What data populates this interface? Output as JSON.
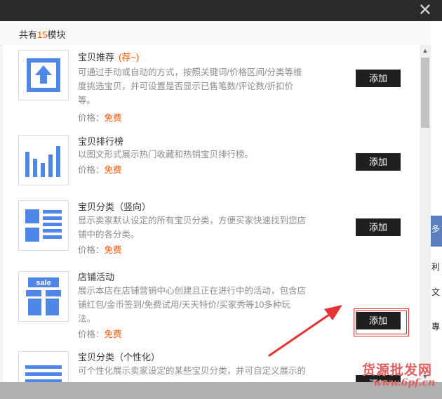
{
  "header": {
    "prefix": "共有",
    "count": "15",
    "suffix": "模块"
  },
  "icons": {
    "close": "close-icon",
    "arrow": "annotation-arrow"
  },
  "colors": {
    "accent": "#ff5500",
    "thumb_blue": "#4f87e8",
    "button": "#1f1f1f",
    "annotation": "#e33333"
  },
  "modules": [
    {
      "title": "宝贝推荐",
      "tag": "(荐~)",
      "desc": [
        "可通过手动或自动的方式，按照关键词/价格区间/分类等维",
        "度挑选宝贝，并可设置是否显示已售笔数/评论数/折扣价",
        "等。"
      ],
      "price_label": "价格：",
      "price": "免费",
      "button": "添加",
      "icon": "upload-arrow-icon"
    },
    {
      "title": "宝贝排行榜",
      "tag": "",
      "desc": [
        "以图文形式展示热门收藏和热销宝贝排行榜。"
      ],
      "price_label": "价格：",
      "price": "免费",
      "button": "添加",
      "icon": "bar-chart-icon"
    },
    {
      "title": "宝贝分类（竖向）",
      "tag": "",
      "desc": [
        "显示卖家默认设定的所有宝贝分类，方便买家快速找到您店",
        "铺中的各分类。"
      ],
      "price_label": "价格：",
      "price": "免费",
      "button": "添加",
      "icon": "category-list-icon"
    },
    {
      "title": "店铺活动",
      "tag": "",
      "desc": [
        "展示本店在店铺营销中心创建且正在进行中的活动，包含店",
        "铺红包/金币签到/免费试用/天天特价/买家秀等10多种玩",
        "法。"
      ],
      "price_label": "价格：",
      "price": "免费",
      "button": "添加",
      "icon": "gift-sale-icon",
      "sale_text": "sale"
    },
    {
      "title": "宝贝分类（个性化）",
      "tag": "",
      "desc": [
        "可个性化展示卖家设定的某些宝贝分类，并可自定义展示的"
      ],
      "button": "添加",
      "icon": "horizontal-lines-icon"
    }
  ],
  "scrollbar": {
    "up": "▲",
    "down": "▼"
  },
  "right_strip": {
    "frag1": "利",
    "frag2": "多",
    "frag3": "文",
    "frag4": "專"
  },
  "watermark": {
    "text": "货源批发网",
    "url": "www.6pf.cn"
  }
}
